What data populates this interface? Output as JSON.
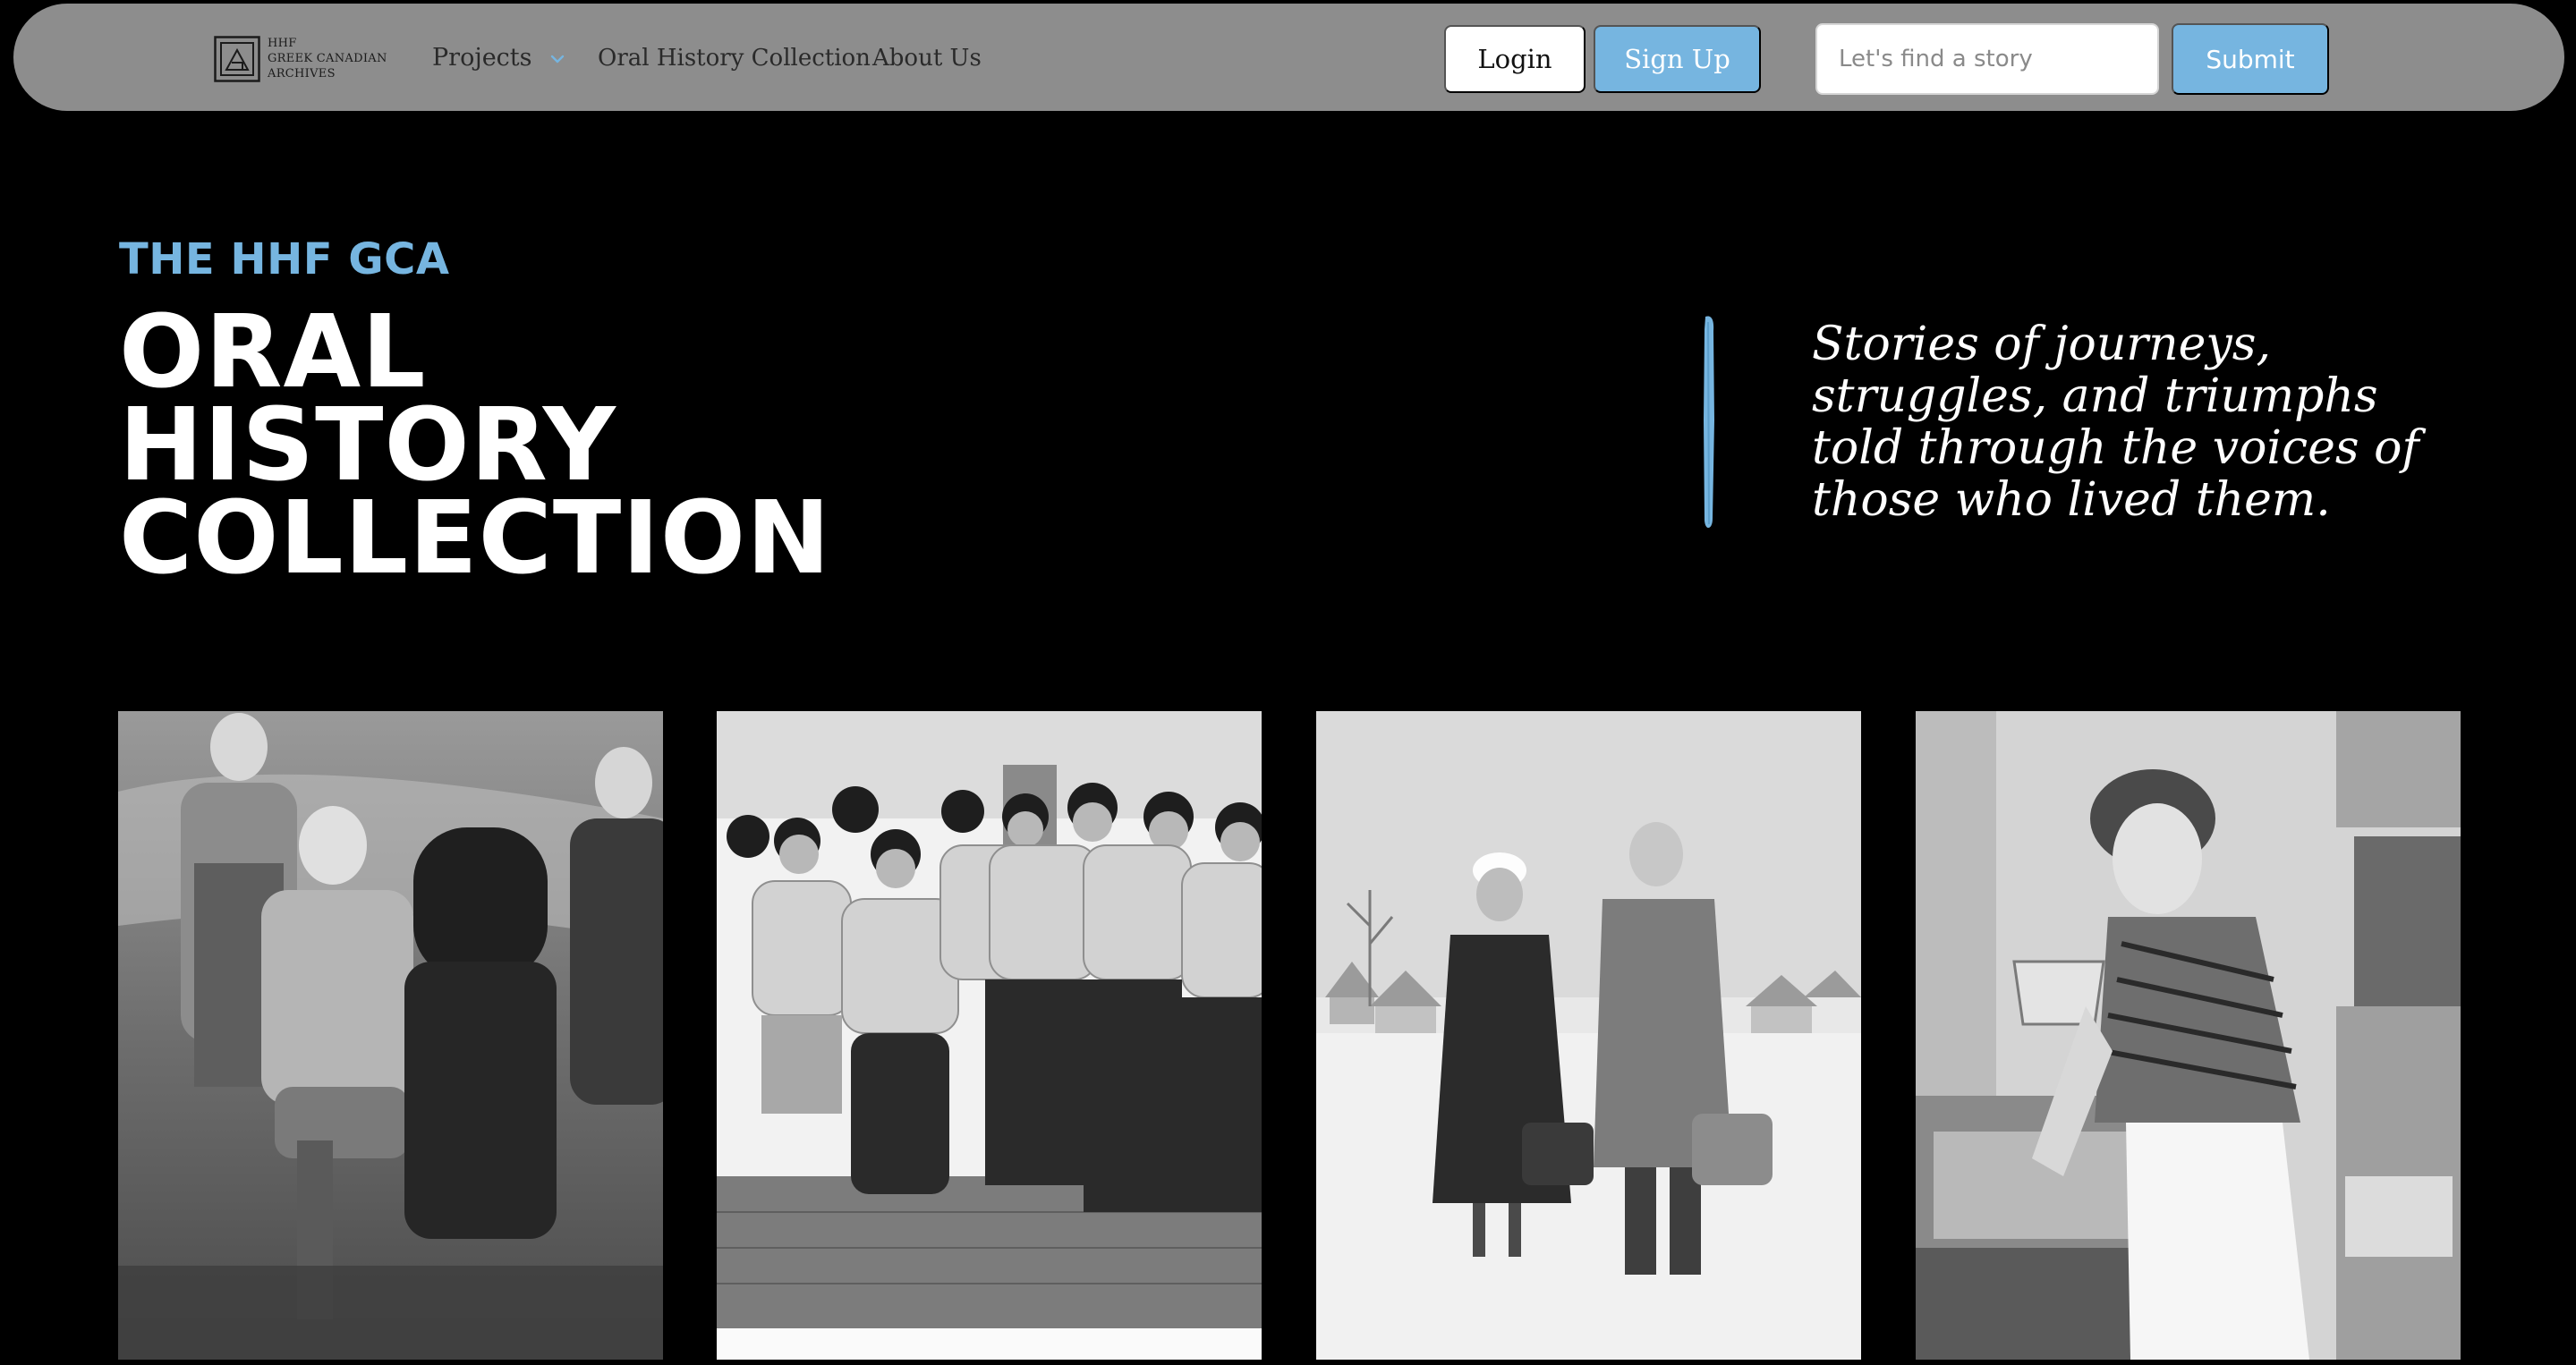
{
  "nav": {
    "logo": {
      "line1": "HHF",
      "line2": "GREEK CANADIAN",
      "line3": "ARCHIVES"
    },
    "links": {
      "projects": "Projects",
      "oral_history": "Oral History Collection",
      "about": "About Us"
    },
    "login_label": "Login",
    "signup_label": "Sign Up",
    "search": {
      "placeholder": "Let's find a story",
      "value": ""
    },
    "submit_label": "Submit"
  },
  "hero": {
    "eyebrow": "THE HHF GCA",
    "title_lines": [
      "ORAL",
      "HISTORY",
      "COLLECTION"
    ],
    "tagline": "Stories of journeys, struggles, and triumphs told through the voices of those who lived them."
  },
  "gallery": {
    "photos": [
      {
        "name": "family-seated-outdoors-photo"
      },
      {
        "name": "group-in-life-jackets-photo"
      },
      {
        "name": "couple-in-snow-photo"
      },
      {
        "name": "woman-at-kitchen-sink-photo"
      }
    ]
  },
  "colors": {
    "accent": "#76b5e0",
    "nav_bg": "#8d8d8d",
    "page_bg": "#000000",
    "text": "#ffffff"
  }
}
